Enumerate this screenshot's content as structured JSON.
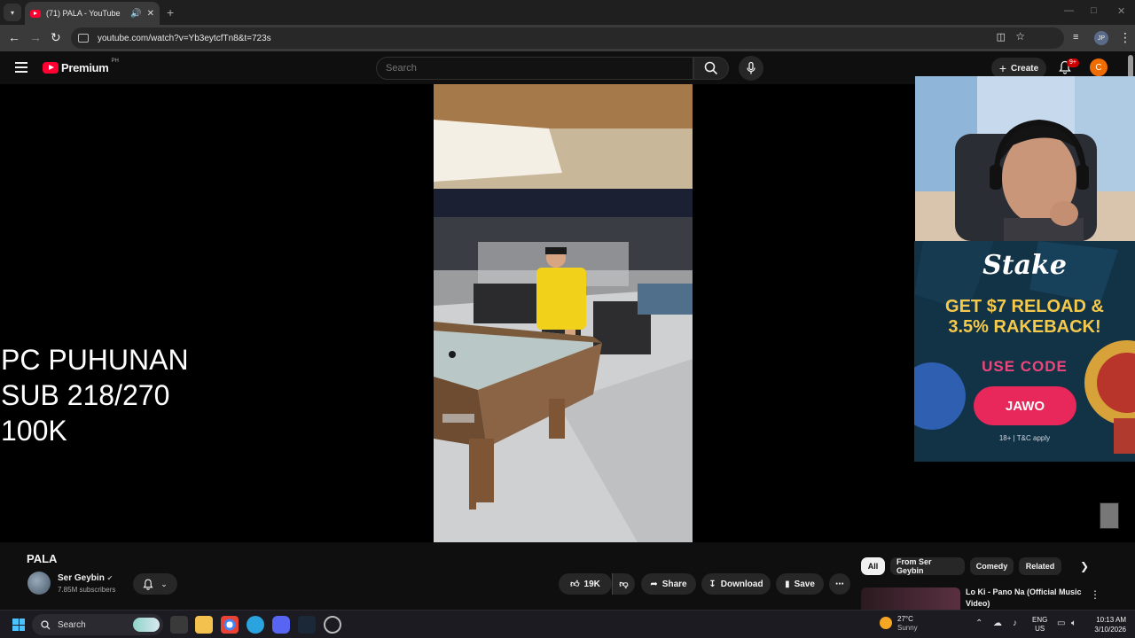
{
  "browser": {
    "tab_title": "(71) PALA - YouTube",
    "new_tab": "+",
    "url": "youtube.com/watch?v=Yb3eytcfTn8&t=723s",
    "profile_initials": "JP"
  },
  "header": {
    "logo_text": "Premium",
    "country_code": "PH",
    "search_placeholder": "Search",
    "create_label": "Create",
    "notification_count": "9+",
    "account_initial": "C"
  },
  "overlay": {
    "text": "PC PUHUNAN\nSUB 218/270\n100K"
  },
  "ad": {
    "brand": "Stake",
    "headline_1": "GET $7 RELOAD &",
    "headline_2": "3.5% RAKEBACK!",
    "use_code": "USE CODE",
    "code": "JAWO",
    "disclaimer": "18+ | T&C apply"
  },
  "video": {
    "title": "PALA",
    "channel_name": "Ser Geybin",
    "subscribers": "7.85M subscribers",
    "likes": "19K",
    "share_label": "Share",
    "download_label": "Download",
    "save_label": "Save"
  },
  "chips": [
    "All",
    "From Ser Geybin",
    "Comedy",
    "Related"
  ],
  "recommendation": {
    "title": "Lo Ki - Pano Na (Official Music Video)"
  },
  "taskbar": {
    "search_label": "Search",
    "weather_temp": "27°C",
    "weather_desc": "Sunny",
    "lang_1": "ENG",
    "lang_2": "US",
    "time": "10:13 AM",
    "date": "3/10/2026"
  }
}
